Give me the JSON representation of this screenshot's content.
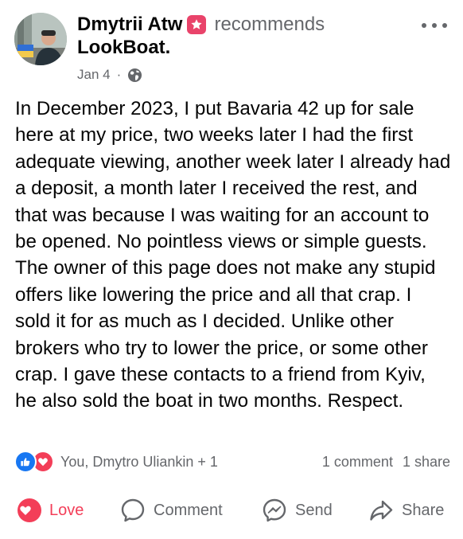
{
  "post": {
    "author": "Dmytrii Atw",
    "action_text": "recommends",
    "page_name": "LookBoat",
    "page_suffix": ".",
    "date": "Jan 4",
    "separator": "·",
    "audience_icon": "globe-icon",
    "text": "In December 2023, I put Bavaria 42 up for sale here at my price, two weeks later I had the first adequate viewing, another week later I already had a deposit, a month later I received the rest, and that was because I was waiting for an account to be opened. No pointless views or simple guests. The owner of this page does not make any stupid offers like lowering the price and all that crap. I sold it for as much as I decided. Unlike other brokers who try to lower the price, or some other crap. I gave these contacts to a friend from Kyiv, he also sold the boat in two months. Respect."
  },
  "reactions": {
    "icons": [
      "like-icon",
      "love-icon"
    ],
    "summary": "You, Dmytro Uliankin + 1",
    "comments": "1 comment",
    "shares": "1 share"
  },
  "actions": {
    "love": "Love",
    "comment": "Comment",
    "send": "Send",
    "share": "Share"
  },
  "colors": {
    "love": "#f33e58",
    "like": "#1877f2",
    "recommend_badge": "#e9436a",
    "secondary_text": "#65676b"
  }
}
